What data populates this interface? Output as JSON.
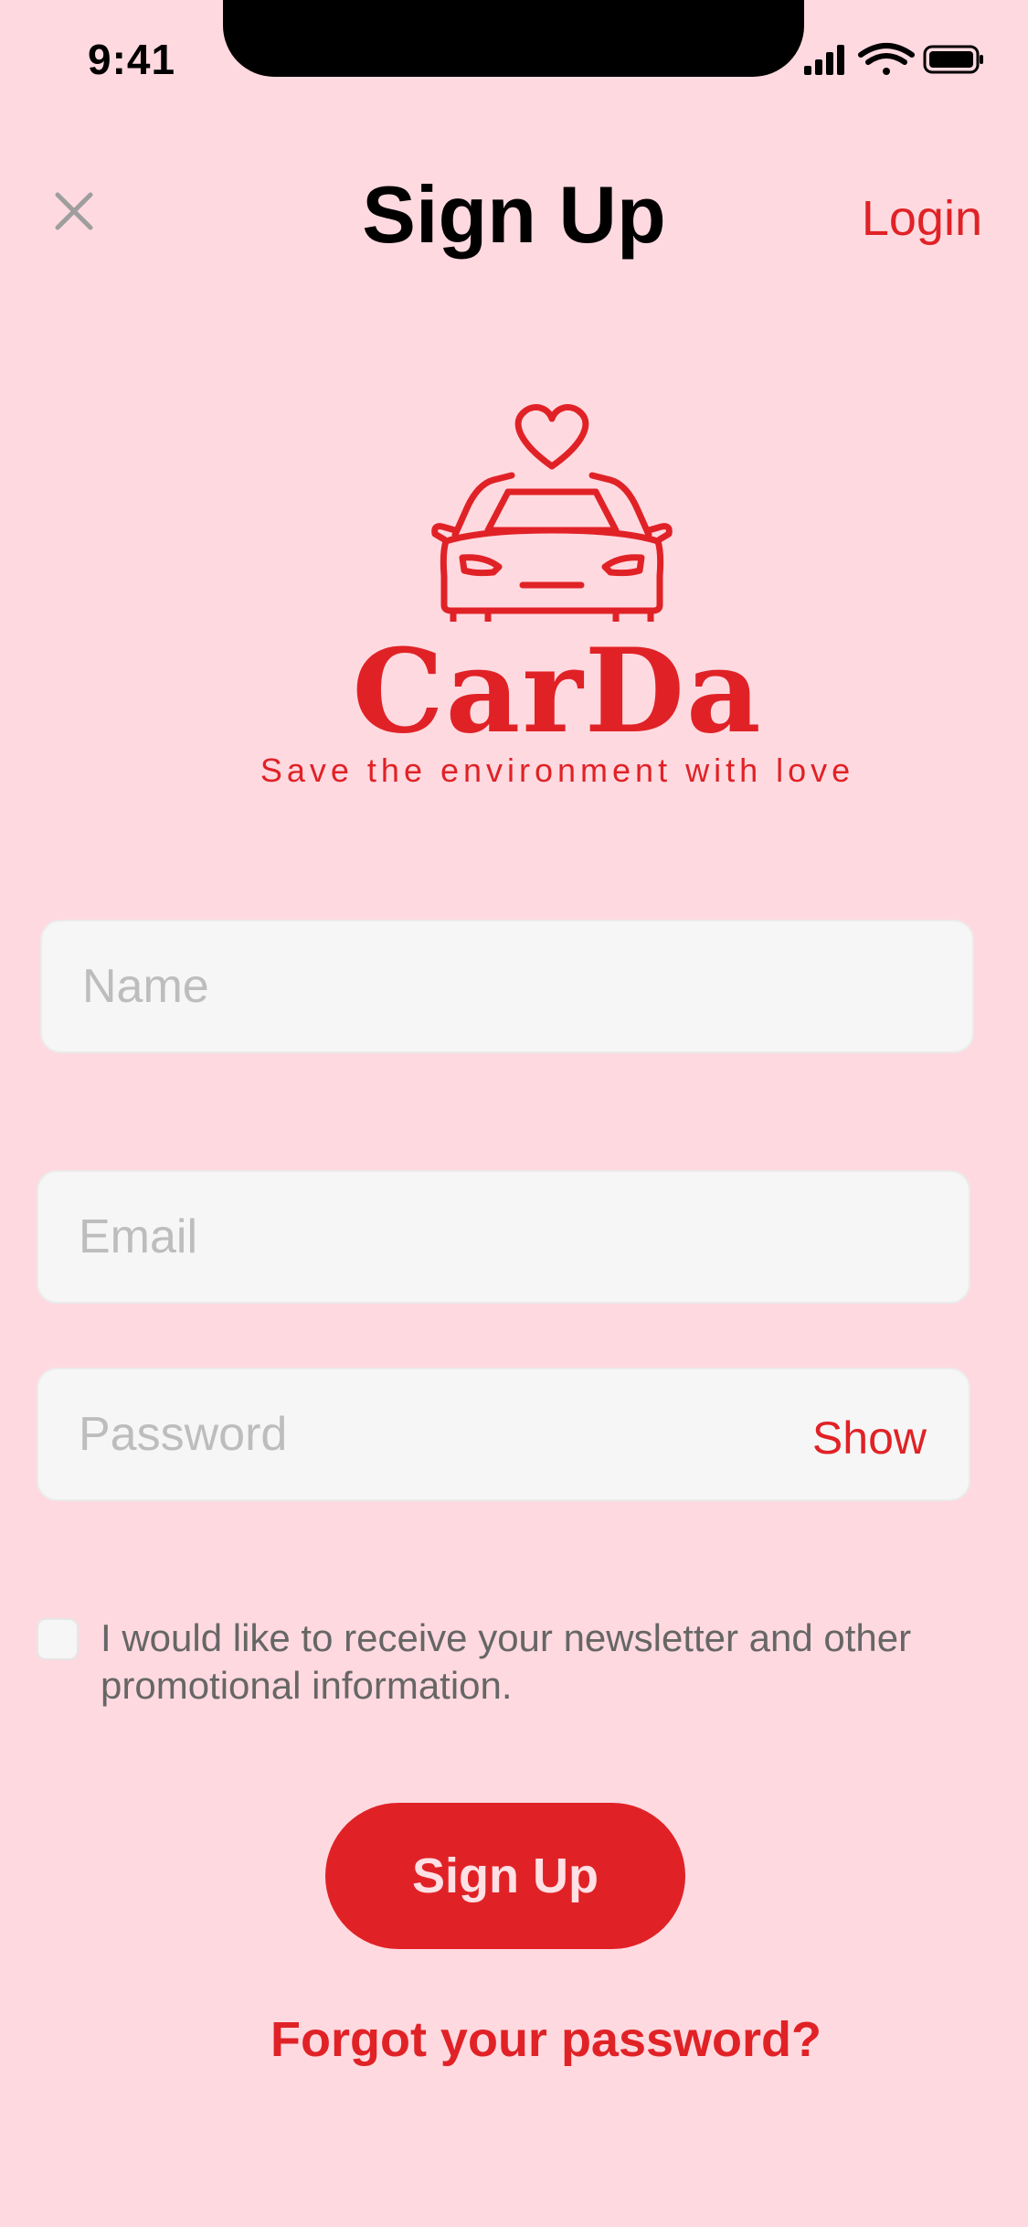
{
  "status_bar": {
    "time": "9:41",
    "icons": [
      "cellular-signal-icon",
      "wifi-icon",
      "battery-icon"
    ]
  },
  "header": {
    "close_icon": "close-icon",
    "title": "Sign Up",
    "login_label": "Login"
  },
  "logo": {
    "icon": "car-heart-icon",
    "name": "CarDa",
    "tagline": "Save the environment with love"
  },
  "form": {
    "name_placeholder": "Name",
    "email_placeholder": "Email",
    "password_placeholder": "Password",
    "show_label": "Show",
    "newsletter_checked": false,
    "newsletter_label": "I would like to receive your newsletter and other promotional information.",
    "submit_label": "Sign Up",
    "forgot_label": "Forgot your password?"
  },
  "colors": {
    "background": "#FFD9E0",
    "accent": "#E02226",
    "field_bg": "#F6F6F6",
    "placeholder": "#BDBDBD"
  }
}
